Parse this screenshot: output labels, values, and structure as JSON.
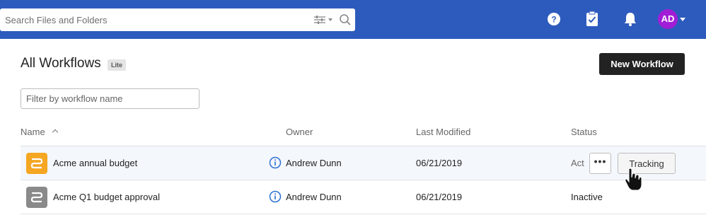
{
  "header": {
    "search_placeholder": "Search Files and Folders",
    "avatar_initials": "AD",
    "avatar_color": "#a11ed6",
    "brand_color": "#2d5bbd",
    "icons": [
      "filter-icon",
      "search-icon",
      "help-icon",
      "tasks-icon",
      "bell-icon"
    ]
  },
  "page": {
    "title": "All Workflows",
    "badge": "Lite",
    "new_button": "New Workflow",
    "filter_placeholder": "Filter by workflow name"
  },
  "table": {
    "columns": {
      "name": "Name",
      "owner": "Owner",
      "modified": "Last Modified",
      "status": "Status"
    },
    "rows": [
      {
        "name": "Acme annual budget",
        "owner": "Andrew Dunn",
        "modified": "06/21/2019",
        "status": "Active",
        "status_visible": "Act",
        "icon_color": "#f5a623",
        "hovered": true
      },
      {
        "name": "Acme Q1 budget approval",
        "owner": "Andrew Dunn",
        "modified": "06/21/2019",
        "status": "Inactive",
        "icon_color": "#8a8a8a",
        "hovered": false
      }
    ],
    "row_actions": {
      "more": "•••",
      "tracking": "Tracking"
    }
  }
}
